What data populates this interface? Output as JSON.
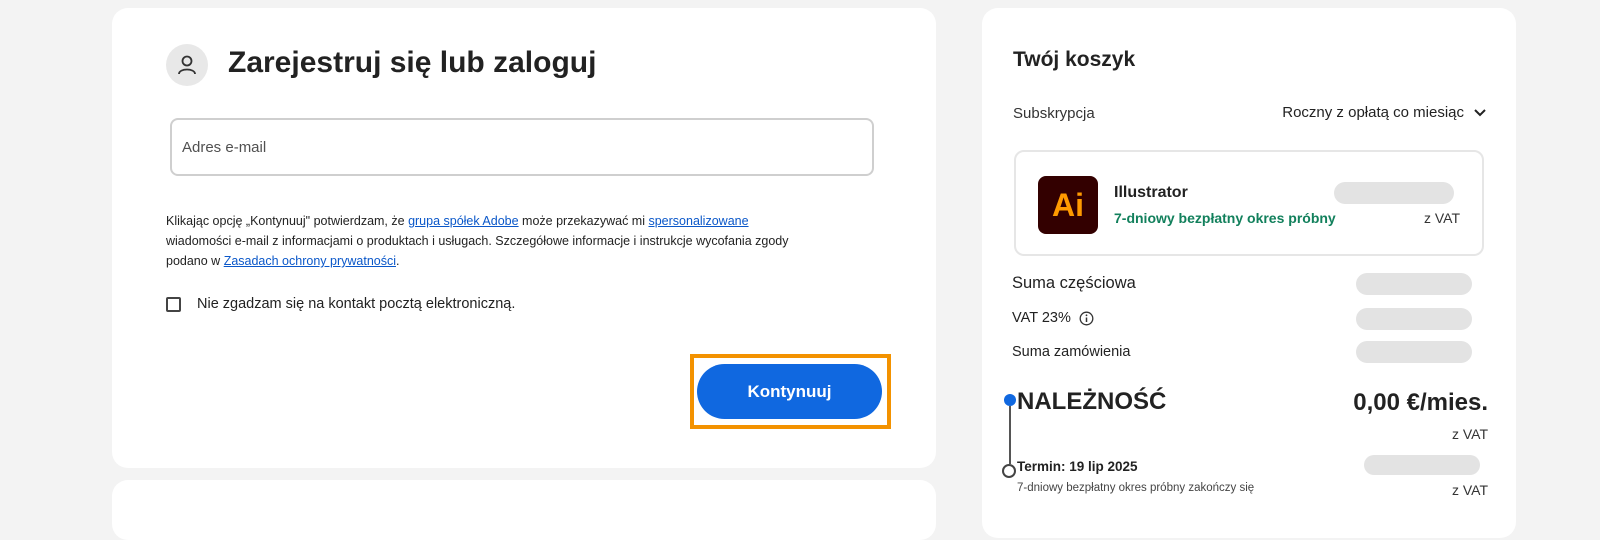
{
  "signin": {
    "title": "Zarejestruj się lub zaloguj",
    "email_placeholder": "Adres e-mail",
    "consent_part1": "Klikając opcję „Kontynuuj\" potwierdzam, że ",
    "consent_link1": "grupa spółek Adobe",
    "consent_part2": " może przekazywać mi ",
    "consent_link2": "spersonalizowane",
    "consent_part3": " wiadomości e-mail z informacjami o produktach i usługach. Szczegółowe informacje i instrukcje wycofania zgody podano w ",
    "consent_link3": "Zasadach ochrony prywatności",
    "consent_part4": ".",
    "opt_out_label": "Nie zgadzam się na kontakt pocztą elektroniczną.",
    "continue_label": "Kontynuuj"
  },
  "cart": {
    "title": "Twój koszyk",
    "subscription_label": "Subskrypcja",
    "subscription_value": "Roczny z opłatą co miesiąc",
    "product": {
      "logo_text": "Ai",
      "name": "Illustrator",
      "trial": "7-dniowy bezpłatny okres próbny",
      "vat_note": "z VAT"
    },
    "subtotal_label": "Suma częściowa",
    "vat_label": "VAT 23%",
    "order_total_label": "Suma zamówienia",
    "due_label": "NALEŻNOŚĆ",
    "due_amount": "0,00 €/mies.",
    "due_vat_note": "z VAT",
    "term_label": "Termin: 19 lip 2025",
    "term_note": "7-dniowy bezpłatny okres próbny zakończy się",
    "term_vat_note": "z VAT"
  },
  "colors": {
    "accent": "#1068e0",
    "highlight": "#f39200",
    "trial_green": "#12805c",
    "illustrator_bg": "#330000",
    "illustrator_fg": "#ff9a00"
  },
  "icons": [
    "user-icon",
    "chevron-down-icon",
    "info-icon"
  ]
}
